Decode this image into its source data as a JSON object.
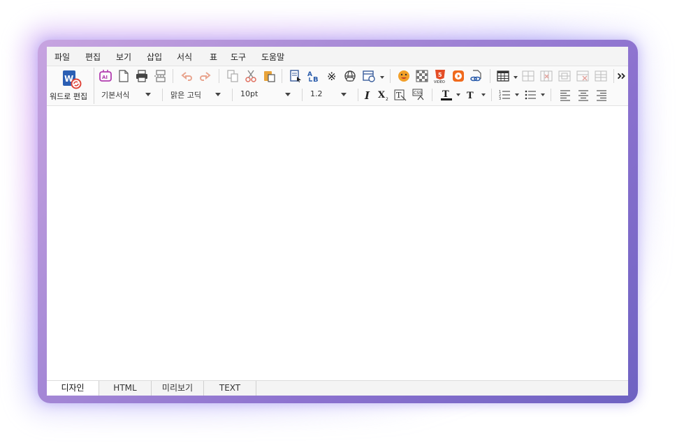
{
  "menu": [
    "파일",
    "편집",
    "보기",
    "삽입",
    "서식",
    "표",
    "도구",
    "도움말"
  ],
  "word_button": {
    "label": "워드로 편집",
    "icon": "word-convert-icon"
  },
  "toolbar_icons": [
    "ai-icon",
    "new-document-icon",
    "print-icon",
    "page-break-icon",
    "undo-icon",
    "redo-icon",
    "copy-icon",
    "cut-icon",
    "paste-icon",
    "select-all-icon",
    "spellcheck-icon",
    "special-char-icon",
    "web-link-icon",
    "date-time-icon",
    "emoji-icon",
    "background-icon",
    "html5-video-icon",
    "media-play-icon",
    "hyperlink-icon",
    "table-icon",
    "table-insert-row-icon",
    "table-delete-col-icon",
    "table-merge-icon",
    "table-delete-icon",
    "table-split-icon",
    "more-icon"
  ],
  "format": {
    "style": "기본서식",
    "font": "맑은 고딕",
    "size": "10pt",
    "line_height": "1.2"
  },
  "tabs": [
    "디자인",
    "HTML",
    "미리보기",
    "TEXT"
  ],
  "active_tab": "디자인",
  "colors": {
    "accent": "#7b67cc",
    "frame_start": "#c7a4e0",
    "frame_end": "#6e62c2"
  }
}
